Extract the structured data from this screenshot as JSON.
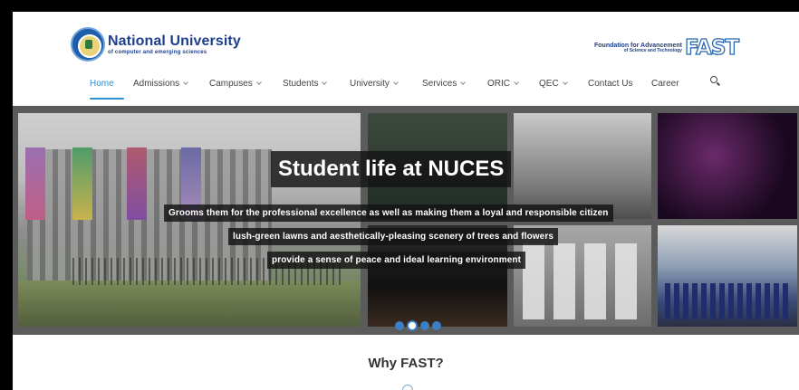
{
  "logo": {
    "title": "National University",
    "subtitle": "of computer and emerging sciences"
  },
  "partner": {
    "line1": "Foundation for Advancement",
    "line2": "of Science and Technology",
    "mark": "FAST"
  },
  "nav": {
    "items": [
      {
        "label": "Home",
        "active": true
      },
      {
        "label": "Admissions",
        "dropdown": true
      },
      {
        "label": "Campuses",
        "dropdown": true
      },
      {
        "label": "Students",
        "dropdown": true
      },
      {
        "label": "University",
        "dropdown": true
      },
      {
        "label": "Services",
        "dropdown": true
      },
      {
        "label": "ORIC",
        "dropdown": true
      },
      {
        "label": "QEC",
        "dropdown": true
      },
      {
        "label": "Contact Us"
      },
      {
        "label": "Career"
      }
    ],
    "search_icon": "search-icon",
    "accent": "#2b8fd0"
  },
  "hero": {
    "title": "Student life at NUCES",
    "captions": [
      "Grooms them for the professional excellence as well as making them a loyal and responsible citizen",
      "lush-green lawns and aesthetically-pleasing scenery of trees and flowers",
      "provide a sense of peace and ideal learning environment"
    ],
    "slide_count": 4,
    "active_slide": 2
  },
  "section": {
    "heading": "Why FAST?"
  }
}
